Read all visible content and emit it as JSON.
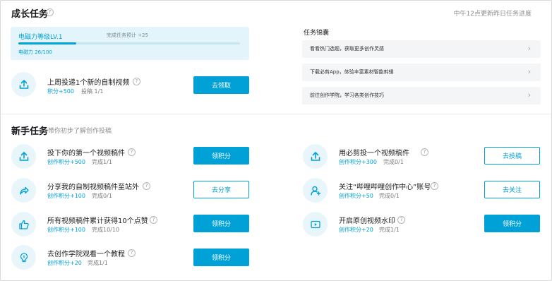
{
  "growth": {
    "title": "成长任务",
    "help": "?",
    "refresh_note": "中午12点更新昨日任务进度",
    "level": {
      "label": "电磁力等级LV.1",
      "tip": "完成任务预计 +25",
      "current": "电磁力 26/100",
      "progress": 0.26
    },
    "weekly_task": {
      "title": "上周投递1个新的自制视频",
      "points": "积分+500",
      "progress": "投稿 1/1",
      "button": "去领取",
      "icon": "upload-icon"
    }
  },
  "tips": {
    "title": "任务锦囊",
    "items": [
      {
        "label": "看看热门选题，获取更多创作灵感"
      },
      {
        "label": "下载必剪App，体验丰富素材智能剪辑"
      },
      {
        "label": "前往创作学院，学习各类创作技巧"
      }
    ],
    "chevron": "›"
  },
  "newbie": {
    "title": "新手任务",
    "subtitle": "带你初步了解创作投稿",
    "tasks": [
      {
        "title": "投下你的第一个视频稿件",
        "points": "创作积分+500",
        "progress": "完成1/1",
        "button": "领积分",
        "style": "primary",
        "icon": "upload-icon"
      },
      {
        "title": "用必剪投一个视频稿件",
        "points": "创作积分+300",
        "progress": "完成0/1",
        "button": "去投稿",
        "style": "outline",
        "icon": "upload-icon"
      },
      {
        "title": "分享我的自制视频稿件至站外",
        "points": "创作积分+100",
        "progress": "完成0/1",
        "button": "去分享",
        "style": "outline",
        "icon": "share-icon"
      },
      {
        "title": "关注“哔哩哔哩创作中心”账号",
        "points": "创作积分+50",
        "progress": "完成0/1",
        "button": "去关注",
        "style": "outline",
        "icon": "follow-user-icon"
      },
      {
        "title": "所有视频稿件累计获得10个点赞",
        "points": "创作积分+100",
        "progress": "完成10/10",
        "button": "领积分",
        "style": "primary",
        "icon": "thumbs-up-icon"
      },
      {
        "title": "开启原创视频水印",
        "points": "创作积分+20",
        "progress": "完成1/1",
        "button": "领积分",
        "style": "primary",
        "icon": "play-icon"
      },
      {
        "title": "去创作学院观看一个教程",
        "points": "创作积分+20",
        "progress": "完成1/1",
        "button": "领积分",
        "style": "primary",
        "icon": "lightbulb-icon"
      }
    ]
  },
  "colors": {
    "accent": "#00a1d6",
    "level_bg": "#e3f4fb",
    "tip_bg": "#f4f5f7"
  }
}
